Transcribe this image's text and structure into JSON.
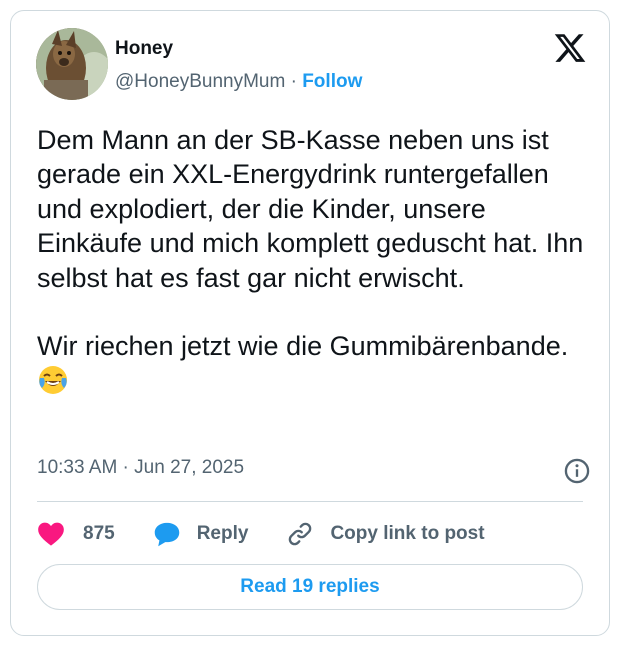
{
  "author": {
    "name": "Honey",
    "handle": "@HoneyBunnyMum",
    "separator": "·",
    "follow_label": "Follow"
  },
  "tweet": {
    "text": "Dem Mann an der SB-Kasse neben uns ist gerade ein XXL-Energydrink runtergefallen und explodiert, der die Kinder, unsere Einkäufe und mich komplett geduscht hat. Ihn selbst hat es fast gar nicht erwischt.\n\nWir riechen jetzt wie die Gummibärenbande. ",
    "emoji": "face-with-tears-of-joy",
    "timestamp": "10:33 AM · Jun 27, 2025"
  },
  "actions": {
    "like_count": "875",
    "reply_label": "Reply",
    "copy_label": "Copy link to post"
  },
  "read_replies_label": "Read 19 replies",
  "colors": {
    "accent": "#1d9bf0",
    "like": "#f91880",
    "text": "#0f1419",
    "muted": "#536471",
    "border": "#cfd9de"
  },
  "icons": [
    "x-logo-icon",
    "info-icon",
    "heart-icon",
    "reply-bubble-icon",
    "link-icon"
  ]
}
